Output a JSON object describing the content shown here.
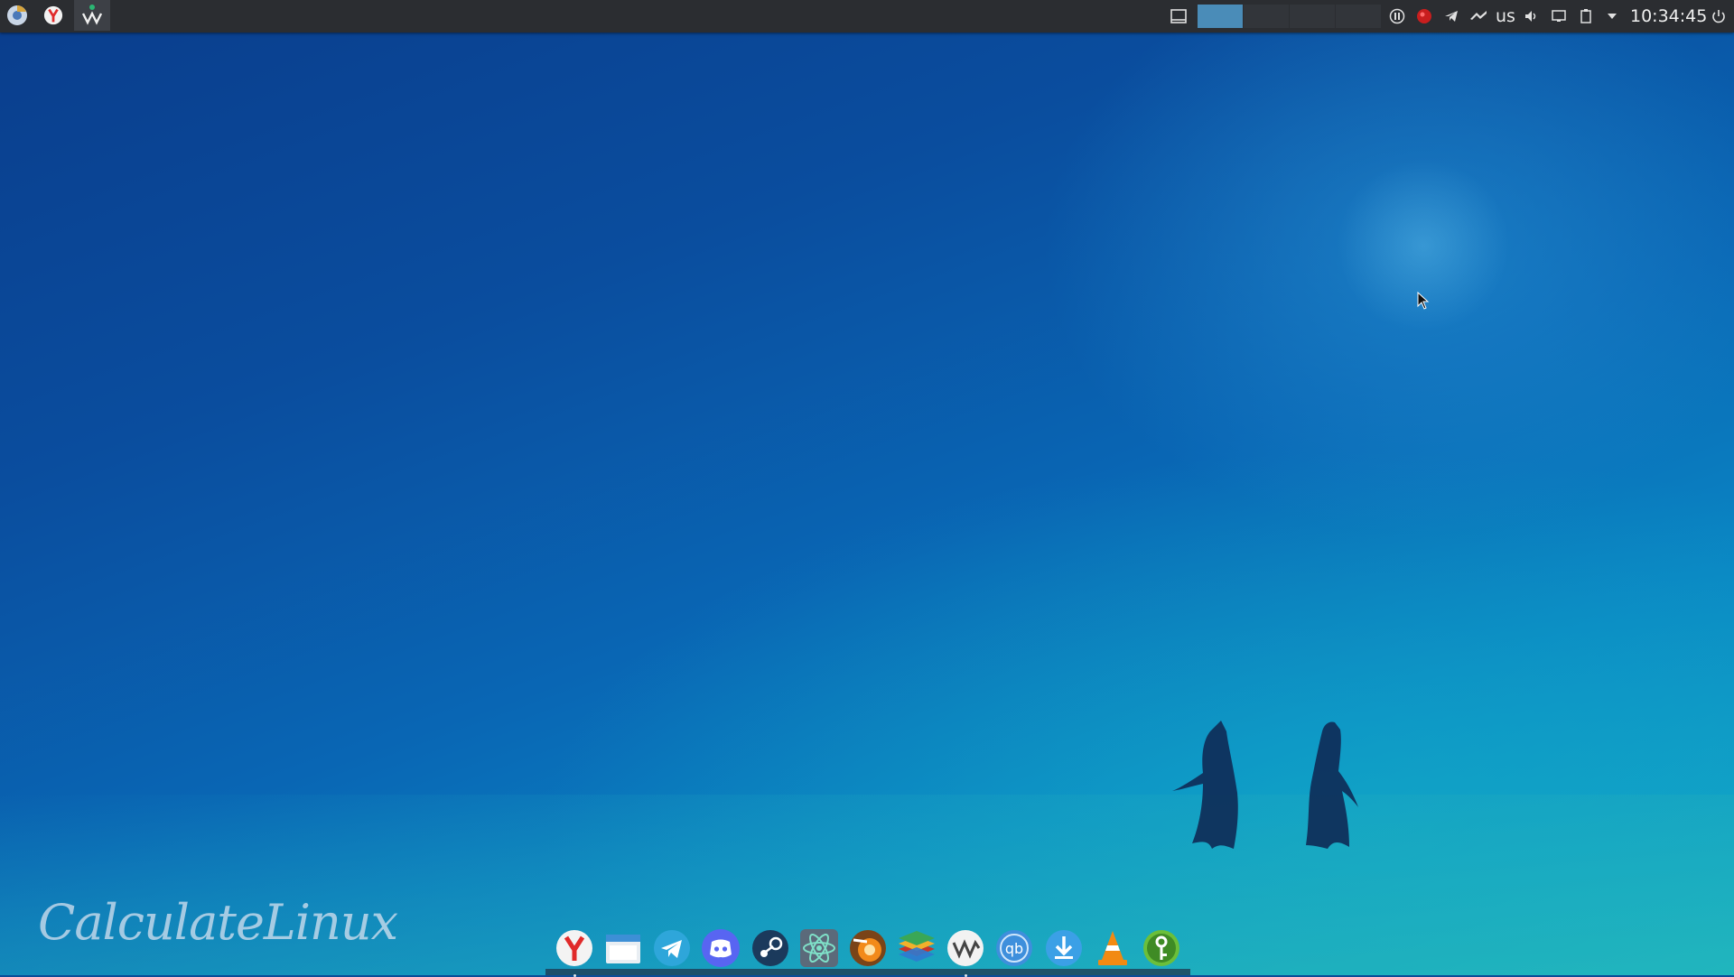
{
  "desktop": {
    "logo_text": "CalculateLinux"
  },
  "top_panel": {
    "launchers": [
      {
        "name": "chromium-icon"
      },
      {
        "name": "yandex-browser-icon"
      },
      {
        "name": "vivaldi-icon"
      }
    ],
    "pager": {
      "desktops": 4,
      "current": 1
    },
    "keyboard_layout": "us",
    "clock": "10:34:45"
  },
  "dock": {
    "items": [
      {
        "name": "yandex-browser-icon",
        "running": true
      },
      {
        "name": "file-manager-icon",
        "running": false
      },
      {
        "name": "telegram-icon",
        "running": false
      },
      {
        "name": "discord-icon",
        "running": false
      },
      {
        "name": "steam-icon",
        "running": false
      },
      {
        "name": "atom-editor-icon",
        "running": false
      },
      {
        "name": "blender-like-icon",
        "running": false
      },
      {
        "name": "layers-app-icon",
        "running": false
      },
      {
        "name": "vivaldi-icon",
        "running": true
      },
      {
        "name": "qbittorrent-icon",
        "running": false
      },
      {
        "name": "download-manager-icon",
        "running": false
      },
      {
        "name": "vlc-icon",
        "running": false
      },
      {
        "name": "keepass-icon",
        "running": false
      }
    ]
  },
  "colors": {
    "panel_bg": "#2b2d31",
    "pager_active": "#4a8cb8",
    "wallpaper_deep": "#0a3d8c",
    "wallpaper_light": "#12a9c8"
  }
}
